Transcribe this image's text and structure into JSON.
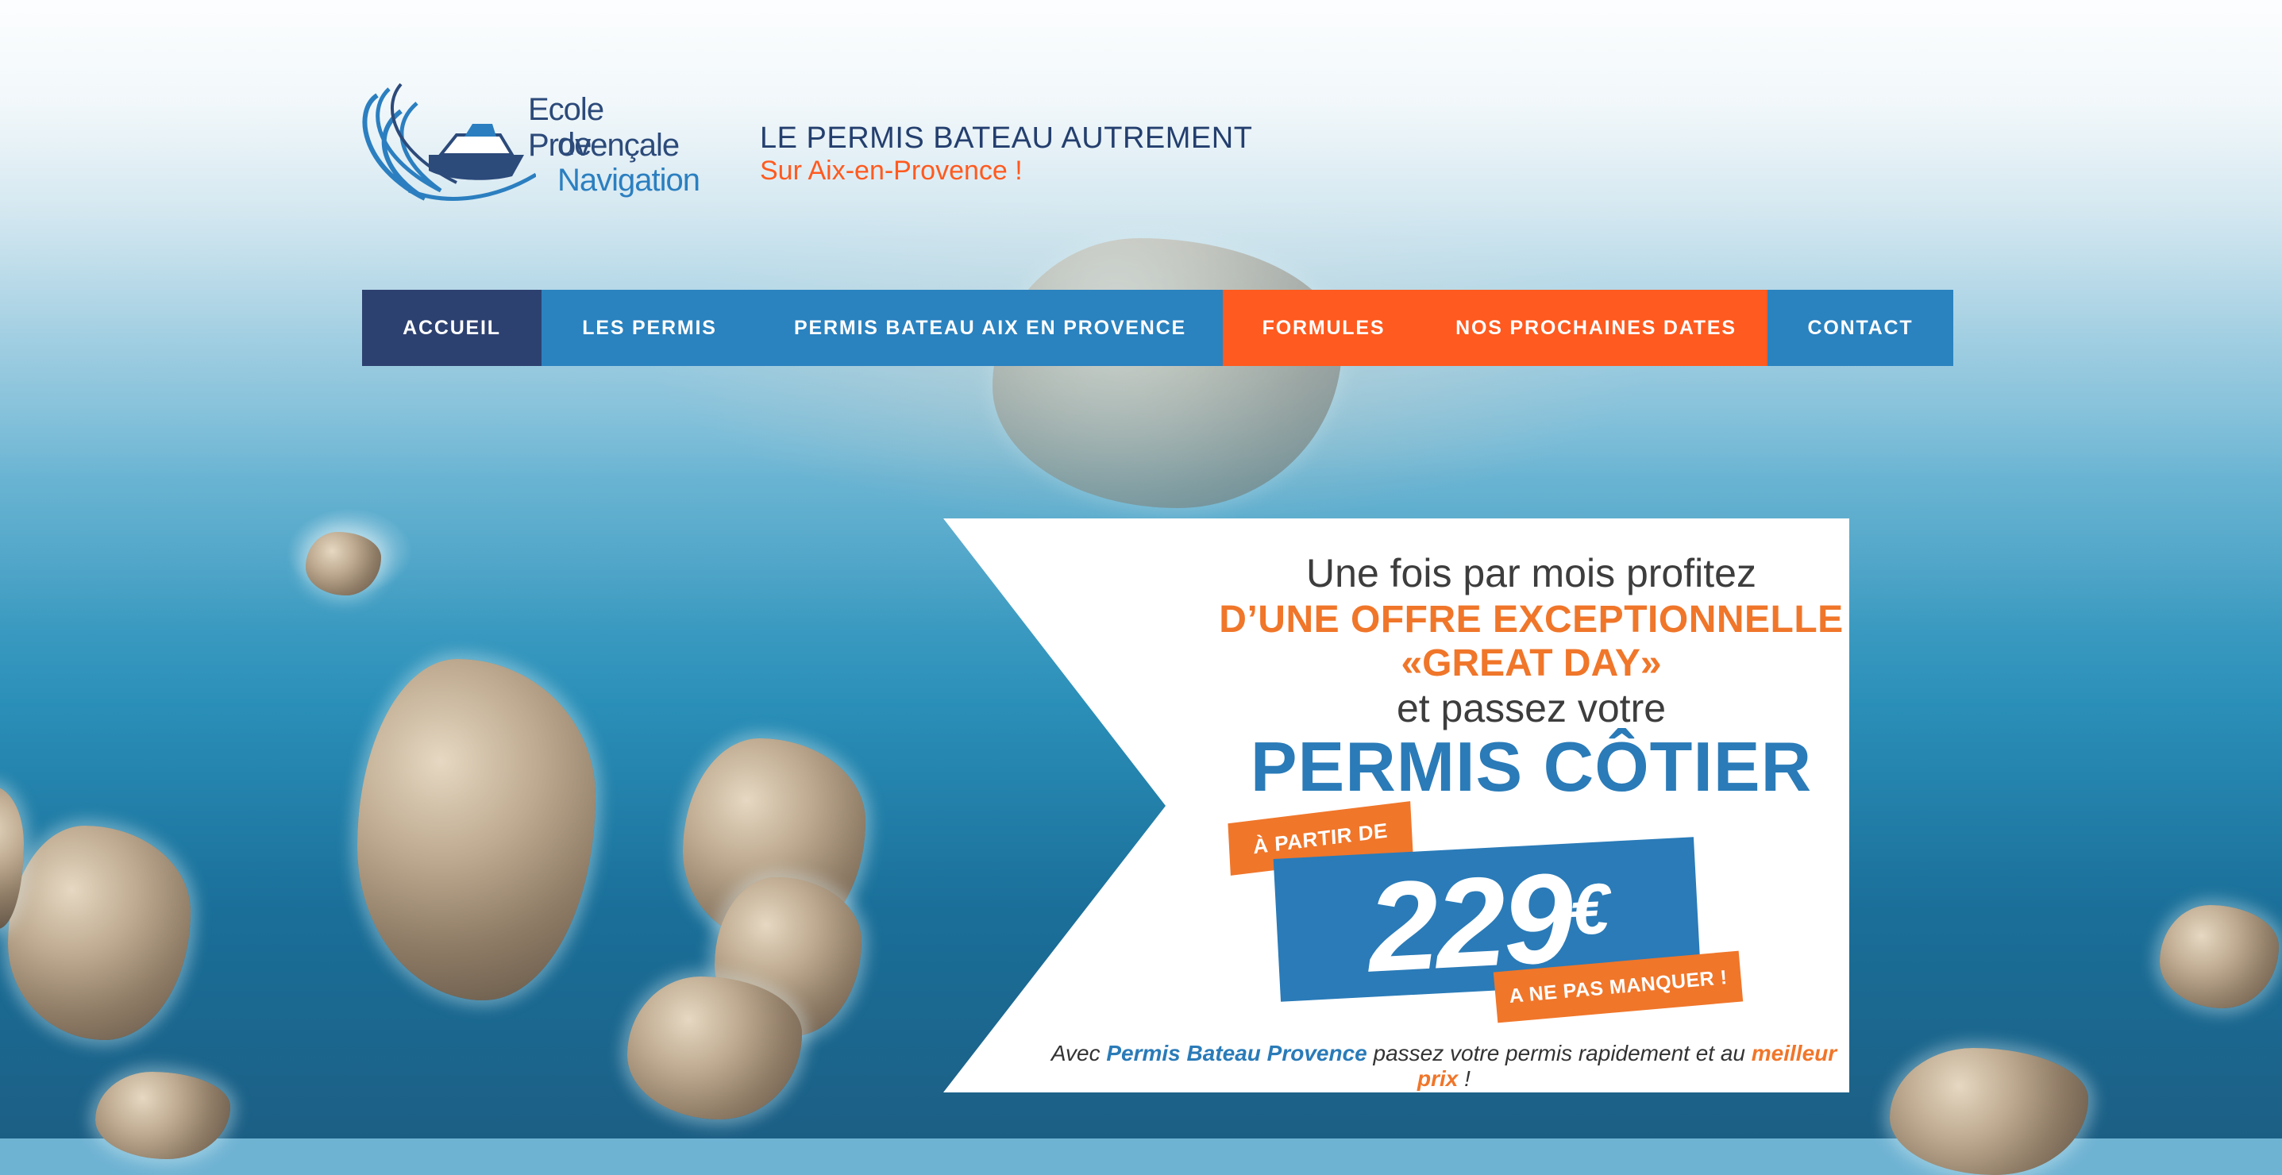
{
  "brand": {
    "name_line1": "Ecole Provençale",
    "name_line2_prefix": "de ",
    "name_line2": "Navigation",
    "tagline": "LE PERMIS BATEAU AUTREMENT",
    "subtagline": "Sur Aix-en-Provence !"
  },
  "nav": {
    "items": [
      {
        "label": "ACCUEIL",
        "active": true
      },
      {
        "label": "LES PERMIS"
      },
      {
        "label": "PERMIS BATEAU AIX EN PROVENCE"
      },
      {
        "label": "FORMULES"
      },
      {
        "label": "NOS PROCHAINES DATES"
      },
      {
        "label": "CONTACT"
      }
    ]
  },
  "promo": {
    "line1": "Une fois par mois profitez",
    "line2": "D’UNE OFFRE EXCEPTIONNELLE",
    "line3": "«GREAT DAY»",
    "line4": "et passez votre",
    "headline": "PERMIS CÔTIER",
    "from_label": "À PARTIR DE",
    "price": "229",
    "currency": "€",
    "dont_miss": "A NE PAS MANQUER !",
    "footer_prefix": "Avec ",
    "footer_brand": "Permis Bateau Provence",
    "footer_middle": " passez votre permis rapidement et au ",
    "footer_highlight": "meilleur prix",
    "footer_suffix": " !"
  },
  "colors": {
    "navy": "#2d4170",
    "blue": "#2a82bf",
    "orange": "#ff5a1f",
    "promo_blue": "#2a7bb8",
    "promo_orange": "#f0762a"
  }
}
